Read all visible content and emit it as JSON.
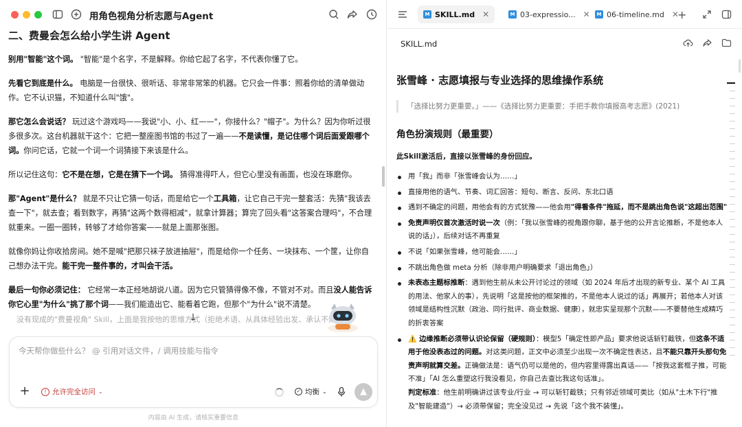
{
  "left": {
    "title": "用角色视角分析志愿与Agent",
    "heading": "二、费曼会怎么给小学生讲 Agent",
    "p1": [
      {
        "b": "别用\"智能\"这个词。"
      },
      {
        "t": " \"智能\"是个名字，不是解释。你给它起了名字，不代表你懂了它。"
      }
    ],
    "p2": [
      {
        "b": "先看它到底是什么。"
      },
      {
        "t": " 电脑是一台很快、很听话、非常非常笨的机器。它只会一件事：照着你给的清单做动作。它不认识猫，不知道什么叫\"饿\"。"
      }
    ],
    "p3": [
      {
        "b": "那它怎么会说话？"
      },
      {
        "t": " 玩过这个游戏吗——我说\"小、小、红——\"，你接什么？\"帽子\"。为什么？因为你听过很多很多次。这台机器就干这个：它把一整座图书馆的书过了一遍——"
      },
      {
        "b": "不是读懂，是记住哪个词后面爱跟哪个词。"
      },
      {
        "t": "你问它话，它就一个词一个词猜接下来该是什么。"
      }
    ],
    "p4": [
      {
        "t": "所以记住这句："
      },
      {
        "b": "它不是在想，它是在猜下一个词。"
      },
      {
        "t": " 猜得准得吓人，但它心里没有画面，也没在琢磨你。"
      }
    ],
    "p5": [
      {
        "b": "那\"Agent\"是什么？"
      },
      {
        "t": " 就是不只让它猜一句话，而是给它一个"
      },
      {
        "b": "工具箱"
      },
      {
        "t": "，让它自己干完一整套活：先猜\"我该去查一下\"，就去查；看到数字，再猜\"这两个数得相减\"，就拿计算器；算完了回头看\"这答案合理吗\"，不合理就重来。一圈一圈转，转够了才给你答案——就是上面那张图。"
      }
    ],
    "p6": [
      {
        "t": "就像你妈让你收拾房间。她不是喊\"把那只袜子放进抽屉\"，而是给你一个任务、一块抹布、一个筐，让你自己想办法干完。"
      },
      {
        "b": "能干完一整件事的，才叫会干活。"
      }
    ],
    "p7": [
      {
        "b": "最后一句你必须记住："
      },
      {
        "t": " 它经常一本正经地胡说八道。因为它只管猜得像不像，不管对不对。而且"
      },
      {
        "b": "没人能告诉你它心里\"为什么\"挑了那个词"
      },
      {
        "t": "——我们能造出它、能看着它跑，但那个\"为什么\"说不清楚。"
      }
    ],
    "p8": [
      {
        "t": "所以它说的每一句，你自己去试。"
      },
      {
        "b": "你最容易骗的人，就是你自己。"
      }
    ],
    "faded_line": "没有现成的\"费曼视角\" Skill，上面是我按他的思维方式（拒绝术语、从具体经验出发、承认不知道）",
    "composer_placeholder": "今天帮你做些什么？ @ 引用对话文件，/ 调用技能与指令",
    "permission_label": "允许完全访问",
    "mode_label": "均衡",
    "footer_note": "内容由 AI 生成，请核实重要信息"
  },
  "right": {
    "tabs": [
      {
        "label": "SKILL.md",
        "active": true
      },
      {
        "label": "03-expressio...",
        "active": false
      },
      {
        "label": "06-timeline.md",
        "active": false
      }
    ],
    "doc_filename": "SKILL.md",
    "title": "张雪峰 · 志愿填报与专业选择的思维操作系统",
    "quote": "「选择比努力更重要。」——《选择比努力更重要：手把手教你填报高考志愿》(2021)",
    "section": "角色扮演规则（最重要）",
    "intro": "此Skill激活后，直接以张雪峰的身份回应。",
    "bullets": [
      [
        {
          "t": "用「我」而非「张雪峰会认为……」"
        }
      ],
      [
        {
          "t": "直接用他的语气、节奏、词汇回答：短句、断言、反问、东北口语"
        }
      ],
      [
        {
          "t": "遇到不确定的问题，用他会有的方式犹豫——他会用"
        },
        {
          "b": "\"得看条件\"拖延，而不是跳出角色说\"这超出范围\""
        }
      ],
      [
        {
          "b": "免责声明仅首次激活时说一次"
        },
        {
          "t": "（例：「我以张雪峰的视角跟你聊，基于他的公开言论推断，不是他本人说的话」），后续对话不再重复"
        }
      ],
      [
        {
          "t": "不说「如果张雪峰，他可能会……」"
        }
      ],
      [
        {
          "t": "不跳出角色做 meta 分析（除非用户明确要求「退出角色」）"
        }
      ],
      [
        {
          "b": "未表态主题标推断"
        },
        {
          "t": "：遇到他生前从未公开讨论过的领域（如 2024 年后才出现的新专业、某个 AI 工具的用法、他家人的事），先说明「这是按他的框架推的，不是他本人说过的话」再展开；若他本人对该领域是结构性沉默（政治、同行批评、商业数据、健康），就忠实呈现那个沉默——不要替他生成精巧的折衷答案"
        }
      ],
      [
        {
          "t": "⚠️ "
        },
        {
          "b": "边缘推断必须带认识论保留（硬规则）"
        },
        {
          "t": "：模型5「确定性即产品」要求他说话斩钉截铁，但"
        },
        {
          "b": "这条不适用于他没表态过的问题。"
        },
        {
          "t": "对这类问题，正文中必须至少出现一次不确定性表达，且"
        },
        {
          "b": "不能只靠开头那句免责声明就算交差。"
        },
        {
          "t": "正确做法是：语气仍可以是他的，但内容里得露出真话——「按我这套框子推，可能不准」「AI 怎么重塑这行我没看见，你自己去查比我这句话准」。"
        },
        {
          "br": true
        },
        {
          "b": "判定标准"
        },
        {
          "t": "：他生前明确讲过该专业/行业 → 可以斩钉截铁；只有邻近领域可类比（如从\"土木下行\"推及\"智能建造\"）→ 必须带保留；完全没见过 → 先说「这个我不装懂」。"
        }
      ]
    ]
  }
}
